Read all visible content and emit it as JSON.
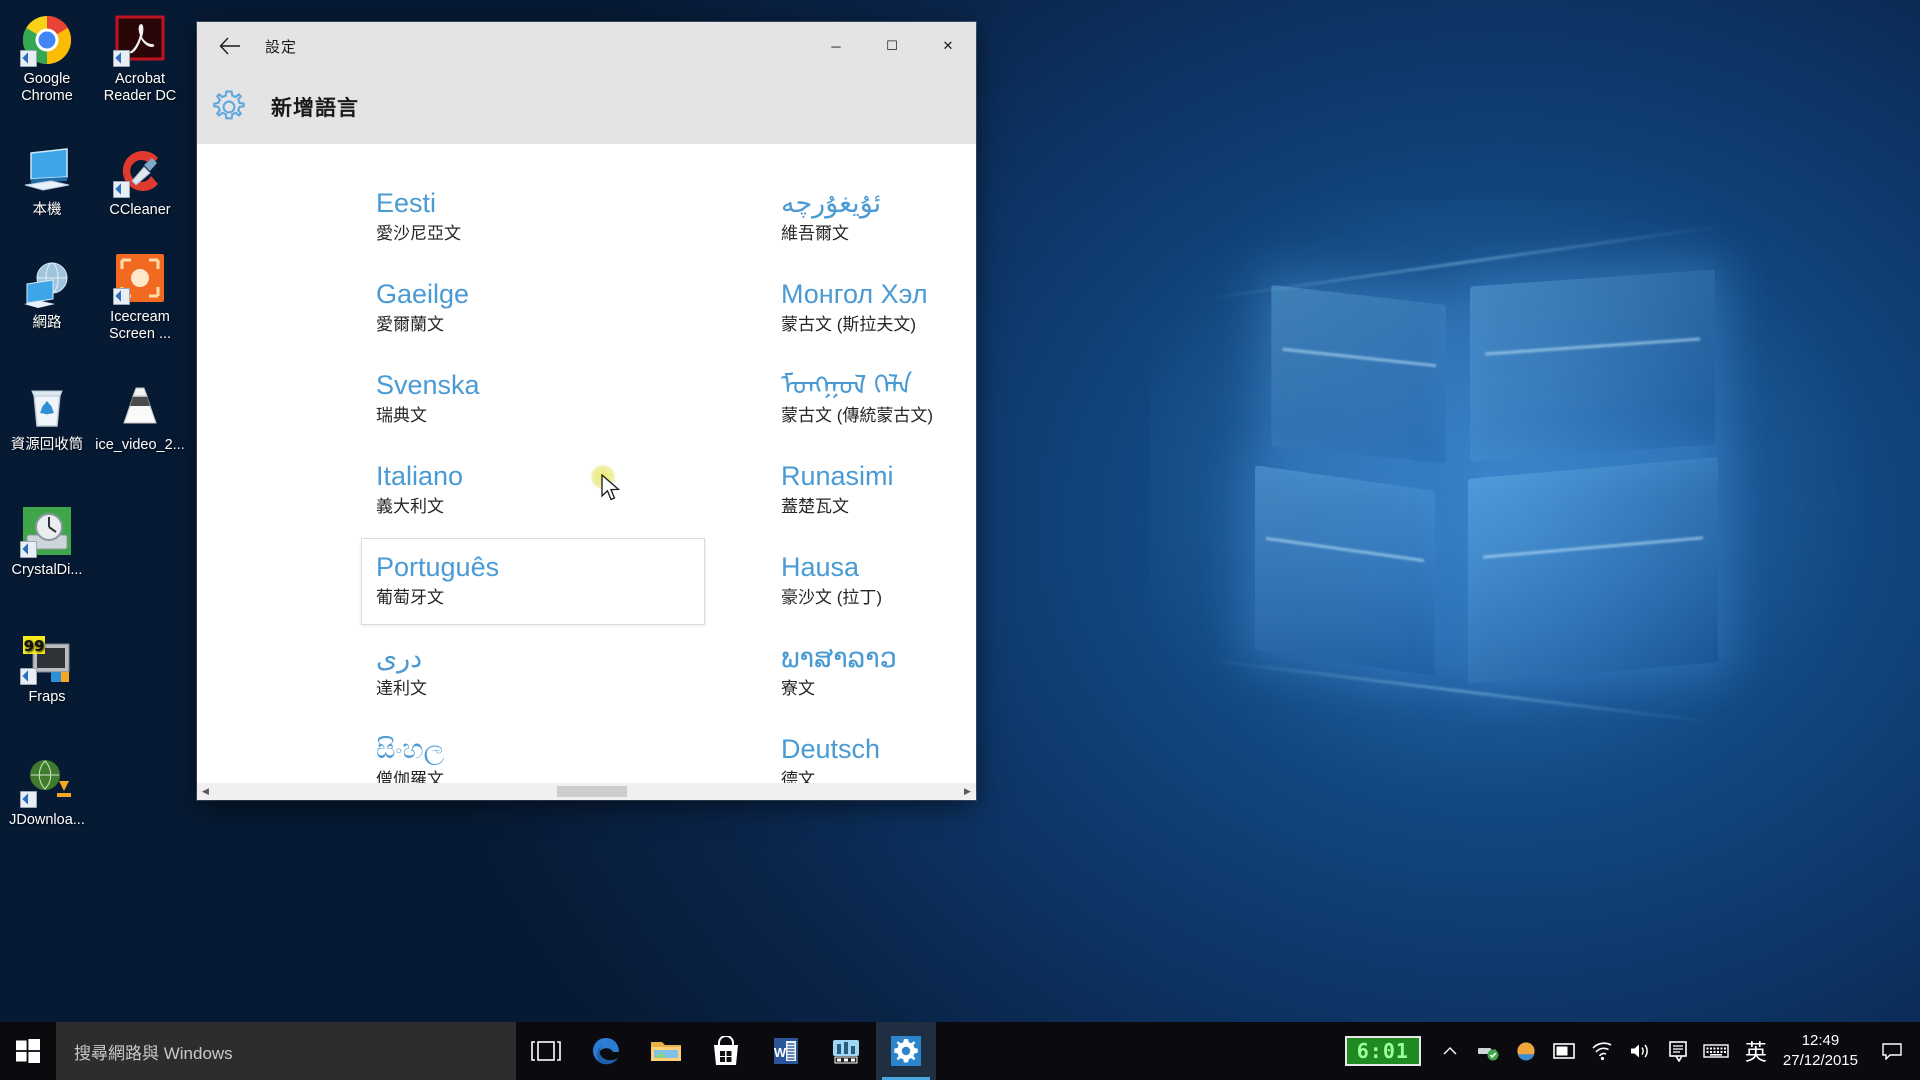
{
  "desktop": {
    "icons": [
      {
        "name": "google-chrome",
        "label": "Google\nChrome",
        "icon": "chrome-icon",
        "shortcut": true
      },
      {
        "name": "acrobat-reader",
        "label": "Acrobat\nReader DC",
        "icon": "acrobat-icon",
        "shortcut": true
      },
      {
        "name": "this-pc",
        "label": "本機",
        "icon": "computer-icon",
        "shortcut": false
      },
      {
        "name": "ccleaner",
        "label": "CCleaner",
        "icon": "ccleaner-icon",
        "shortcut": true
      },
      {
        "name": "network",
        "label": "網路",
        "icon": "network-icon",
        "shortcut": false
      },
      {
        "name": "icecream-screen",
        "label": "Icecream\nScreen ...",
        "icon": "icecream-icon",
        "shortcut": true
      },
      {
        "name": "recycle-bin",
        "label": "資源回收筒",
        "icon": "recycle-bin-icon",
        "shortcut": false
      },
      {
        "name": "ice-video",
        "label": "ice_video_2...",
        "icon": "vlc-cone-icon",
        "shortcut": false
      },
      {
        "name": "crystaldiskinfo",
        "label": "CrystalDi...",
        "icon": "crystaldisk-icon",
        "shortcut": true
      },
      {
        "name": "fraps",
        "label": "Fraps",
        "icon": "fraps-icon",
        "shortcut": true
      },
      {
        "name": "jdownloader",
        "label": "JDownloa...",
        "icon": "jdownloader-icon",
        "shortcut": true
      }
    ]
  },
  "window": {
    "title": "設定",
    "back_icon": "back-arrow-icon",
    "minimize_label": "─",
    "maximize_label": "☐",
    "close_label": "✕",
    "header": {
      "icon": "gear-icon",
      "title": "新增語言"
    },
    "scrollbar": {
      "left_arrow": "◀",
      "right_arrow": "▶"
    }
  },
  "languages": {
    "left_column": [
      {
        "native": "Eesti",
        "local": "愛沙尼亞文",
        "rtl": false,
        "hovered": false
      },
      {
        "native": "Gaeilge",
        "local": "愛爾蘭文",
        "rtl": false,
        "hovered": false
      },
      {
        "native": "Svenska",
        "local": "瑞典文",
        "rtl": false,
        "hovered": false
      },
      {
        "native": "Italiano",
        "local": "義大利文",
        "rtl": false,
        "hovered": false
      },
      {
        "native": "Português",
        "local": "葡萄牙文",
        "rtl": false,
        "hovered": true
      },
      {
        "native": "دری",
        "local": "達利文",
        "rtl": true,
        "hovered": false
      },
      {
        "native": "සිංහල",
        "local": "僧伽羅文",
        "rtl": false,
        "hovered": false
      }
    ],
    "right_column": [
      {
        "native": "ئۇيغۇرچە",
        "local": "維吾爾文",
        "rtl": true,
        "hovered": false
      },
      {
        "native": "Монгол Хэл",
        "local": "蒙古文 (斯拉夫文)",
        "rtl": false,
        "hovered": false
      },
      {
        "native": "ᠮᠣᠩᠭᠣᠯ ᠬᠡᠯᠡ",
        "local": "蒙古文 (傳統蒙古文)",
        "rtl": false,
        "hovered": false
      },
      {
        "native": "Runasimi",
        "local": "蓋楚瓦文",
        "rtl": false,
        "hovered": false
      },
      {
        "native": "Hausa",
        "local": "豪沙文 (拉丁)",
        "rtl": false,
        "hovered": false
      },
      {
        "native": "ພາສາລາວ",
        "local": "寮文",
        "rtl": false,
        "hovered": false
      },
      {
        "native": "Deutsch",
        "local": "德文",
        "rtl": false,
        "hovered": false
      }
    ]
  },
  "taskbar": {
    "start_icon": "windows-start-icon",
    "search_placeholder": "搜尋網路與 Windows",
    "buttons": [
      {
        "name": "task-view",
        "icon": "task-view-icon"
      },
      {
        "name": "edge",
        "icon": "edge-browser-icon"
      },
      {
        "name": "file-explorer",
        "icon": "file-explorer-icon"
      },
      {
        "name": "microsoft-store",
        "icon": "store-bag-icon"
      },
      {
        "name": "word",
        "icon": "word-icon"
      },
      {
        "name": "audio-mixer",
        "icon": "mixer-icon"
      },
      {
        "name": "settings",
        "icon": "gear-icon",
        "active": true
      }
    ],
    "tray": {
      "fraps_timer": "6:01",
      "show_hidden_icon": "chevron-up-icon",
      "icons": [
        {
          "name": "safe-eject",
          "icon": "usb-eject-icon"
        },
        {
          "name": "onedrive-or-weather",
          "icon": "cloud-icon"
        },
        {
          "name": "display-mode",
          "icon": "monitor-icon"
        },
        {
          "name": "network",
          "icon": "wifi-icon"
        },
        {
          "name": "volume",
          "icon": "speaker-icon"
        }
      ],
      "ime_indicator": "英",
      "keyboard_icon": "keyboard-icon",
      "chat_icon": "speech-bubble-icon",
      "clock_time": "12:49",
      "clock_date": "27/12/2015",
      "action_center_icon": "action-center-icon"
    }
  },
  "colors": {
    "accent_link": "#4a9ad4",
    "titlebar_bg": "#e4e4e4",
    "taskbar_bg": "#0a0a0f",
    "fraps_green": "#1f8a1f",
    "close_hover": "#e81123"
  }
}
